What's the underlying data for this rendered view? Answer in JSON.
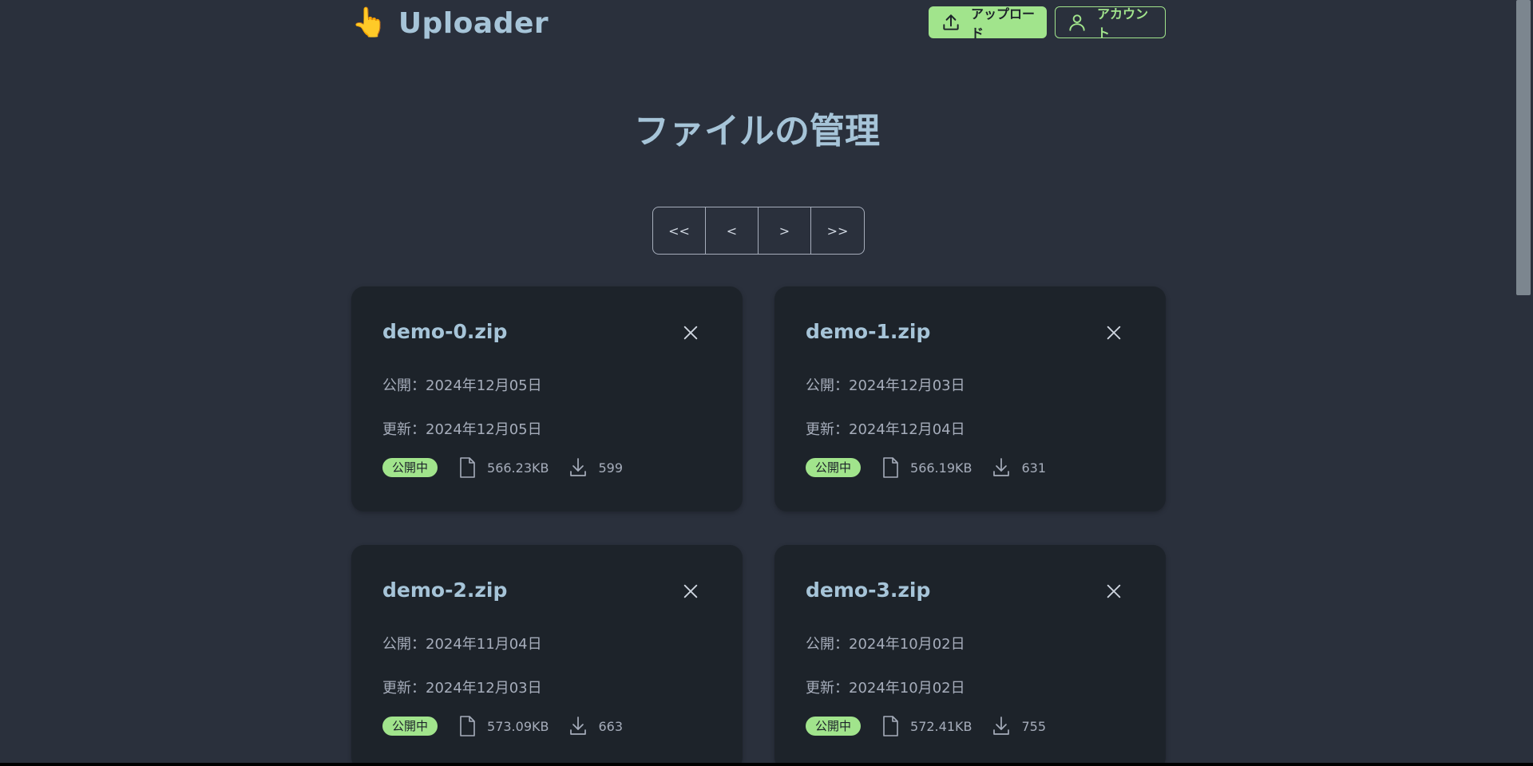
{
  "header": {
    "brand_icon": "👆",
    "brand_title": "Uploader",
    "upload_label": "アップロード",
    "account_label": "アカウント"
  },
  "page": {
    "title": "ファイルの管理"
  },
  "pagination": {
    "first": "<<",
    "prev": "<",
    "next": ">",
    "last": ">>"
  },
  "files": [
    {
      "name": "demo-0.zip",
      "published": "公開：2024年12月05日",
      "updated": "更新：2024年12月05日",
      "status": "公開中",
      "size": "566.23KB",
      "downloads": "599"
    },
    {
      "name": "demo-1.zip",
      "published": "公開：2024年12月03日",
      "updated": "更新：2024年12月04日",
      "status": "公開中",
      "size": "566.19KB",
      "downloads": "631"
    },
    {
      "name": "demo-2.zip",
      "published": "公開：2024年11月04日",
      "updated": "更新：2024年12月03日",
      "status": "公開中",
      "size": "573.09KB",
      "downloads": "663"
    },
    {
      "name": "demo-3.zip",
      "published": "公開：2024年10月02日",
      "updated": "更新：2024年10月02日",
      "status": "公開中",
      "size": "572.41KB",
      "downloads": "755"
    }
  ],
  "icons": {
    "upload": "upload-icon",
    "account": "user-icon",
    "close": "close-icon",
    "file": "file-icon",
    "download": "download-icon"
  },
  "colors": {
    "background": "#2a303c",
    "card": "#1d232a",
    "accent": "#a1e48c",
    "heading": "#a6c4d8",
    "text": "#a6adbb"
  }
}
